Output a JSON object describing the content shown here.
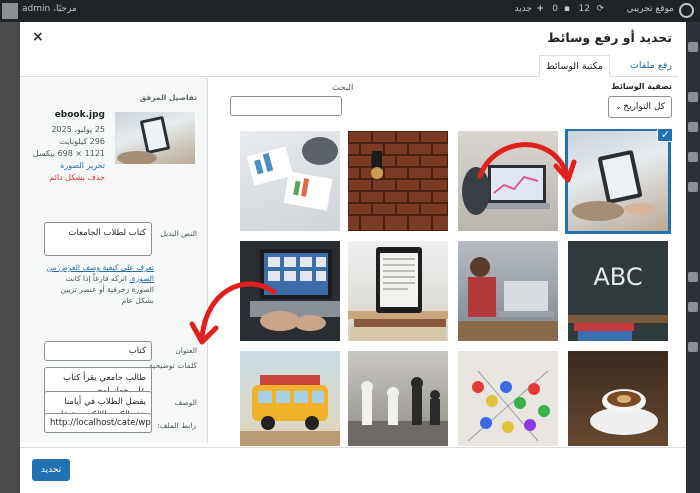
{
  "adminbar": {
    "site_name": "موقع تجريبي",
    "comments_count": "12",
    "updates_count": "0",
    "new_label": "جديد",
    "greeting": "مرحبًا، admin"
  },
  "modal": {
    "title": "تحديد أو رفع وسائط",
    "close_label": "×",
    "tabs": [
      {
        "label": "رفع ملفات"
      },
      {
        "label": "مكتبة الوسائط"
      }
    ]
  },
  "toolbar": {
    "filter_label": "تصفية الوسائط",
    "filter_value": "كل التواريخ",
    "search_label": "البحث"
  },
  "media": [
    {
      "desc": "person holding tablet",
      "selected": true
    },
    {
      "desc": "laptop with charts"
    },
    {
      "desc": "brick wall lamp"
    },
    {
      "desc": "papers and charts"
    },
    {
      "desc": "chalkboard ABC"
    },
    {
      "desc": "students with laptop"
    },
    {
      "desc": "e-reader on books"
    },
    {
      "desc": "laptop typing"
    },
    {
      "desc": "coffee cup"
    },
    {
      "desc": "board game pieces"
    },
    {
      "desc": "chess pieces"
    },
    {
      "desc": "toy bus"
    }
  ],
  "details": {
    "title": "تفاصيل المرفق",
    "filename": "ebook.jpg",
    "date": "25 يوليو، 2025",
    "size": "296 كيلوبايت",
    "dimensions": "1121 × 698 بيكسل",
    "edit_link": "تحرير الصورة",
    "delete_link": "حذف بشكل دائم",
    "alt_label": "النص البديل",
    "alt_value": "كتاب لطلاب الجامعات",
    "alt_help_link": "تعرف على كيفية وصف الغرض من الصورة.",
    "alt_help_text": "اتركه فارغاً إذا كانت الصورة زخرفية أو عنصر تزيين بشكل عام",
    "title_label": "العنوان",
    "title_value": "كتاب",
    "caption_label": "كلمات توضيحية",
    "caption_value": "طالب جامعي يقرأ كتاب على جهاز لوحي",
    "description_label": "الوصف",
    "description_value": "يفضل الطلاب في أيامنا هذه الكتب الإلكترونية على الكتب المطبوعة",
    "url_label": "رابط الملف:",
    "url_value": "http://localhost/cate/wp-"
  },
  "footer": {
    "update_label": "تحديد"
  },
  "colors": {
    "accent": "#2271b1",
    "danger": "#d63638",
    "arrow": "#e0201c"
  }
}
